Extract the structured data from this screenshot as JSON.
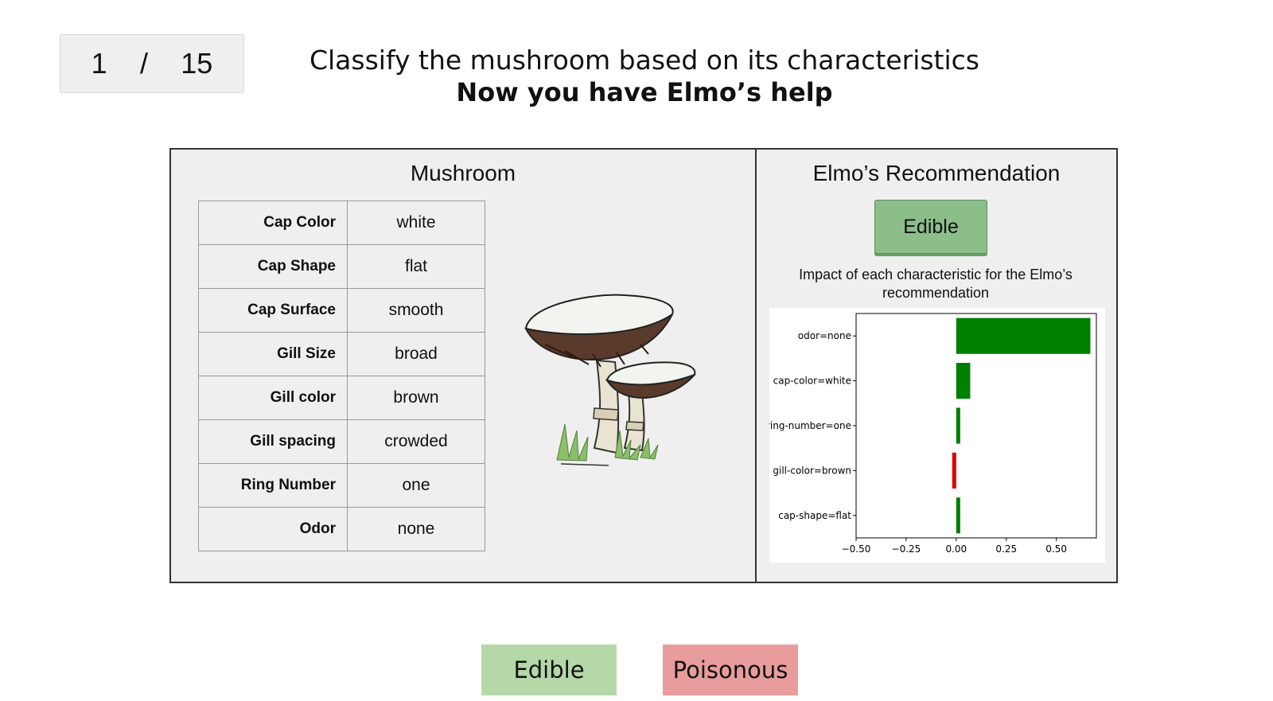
{
  "progress": {
    "current": "1",
    "separator": "/",
    "total": "15"
  },
  "header": {
    "instruction": "Classify the mushroom based on its characteristics",
    "subtitle": "Now you have Elmo’s help"
  },
  "mushroom_panel": {
    "title": "Mushroom",
    "features": [
      {
        "name": "Cap Color",
        "value": "white"
      },
      {
        "name": "Cap Shape",
        "value": "flat"
      },
      {
        "name": "Cap Surface",
        "value": "smooth"
      },
      {
        "name": "Gill Size",
        "value": "broad"
      },
      {
        "name": "Gill color",
        "value": "brown"
      },
      {
        "name": "Gill spacing",
        "value": "crowded"
      },
      {
        "name": "Ring Number",
        "value": "one"
      },
      {
        "name": "Odor",
        "value": "none"
      }
    ]
  },
  "recommendation_panel": {
    "title": "Elmo’s Recommendation",
    "recommendation": "Edible",
    "chart_caption_line1": "Impact of each characteristic for the Elmo’s",
    "chart_caption_line2": "recommendation"
  },
  "chart_data": {
    "type": "bar",
    "orientation": "horizontal",
    "categories": [
      "odor=none",
      "cap-color=white",
      "ring-number=one",
      "gill-color=brown",
      "cap-shape=flat"
    ],
    "values": [
      0.67,
      0.07,
      0.02,
      -0.02,
      0.02
    ],
    "colors": [
      "#008000",
      "#008000",
      "#008000",
      "#e00000",
      "#008000"
    ],
    "xlim": [
      -0.5,
      0.7
    ],
    "xticks": [
      "−0.50",
      "−0.25",
      "0.00",
      "0.25",
      "0.50"
    ],
    "xtick_values": [
      -0.5,
      -0.25,
      0,
      0.25,
      0.5
    ]
  },
  "actions": {
    "edible_label": "Edible",
    "poisonous_label": "Poisonous"
  },
  "colors": {
    "positive": "#008000",
    "negative": "#e00000",
    "edible_button": "#b4d8a8",
    "poisonous_button": "#e99c9c"
  }
}
